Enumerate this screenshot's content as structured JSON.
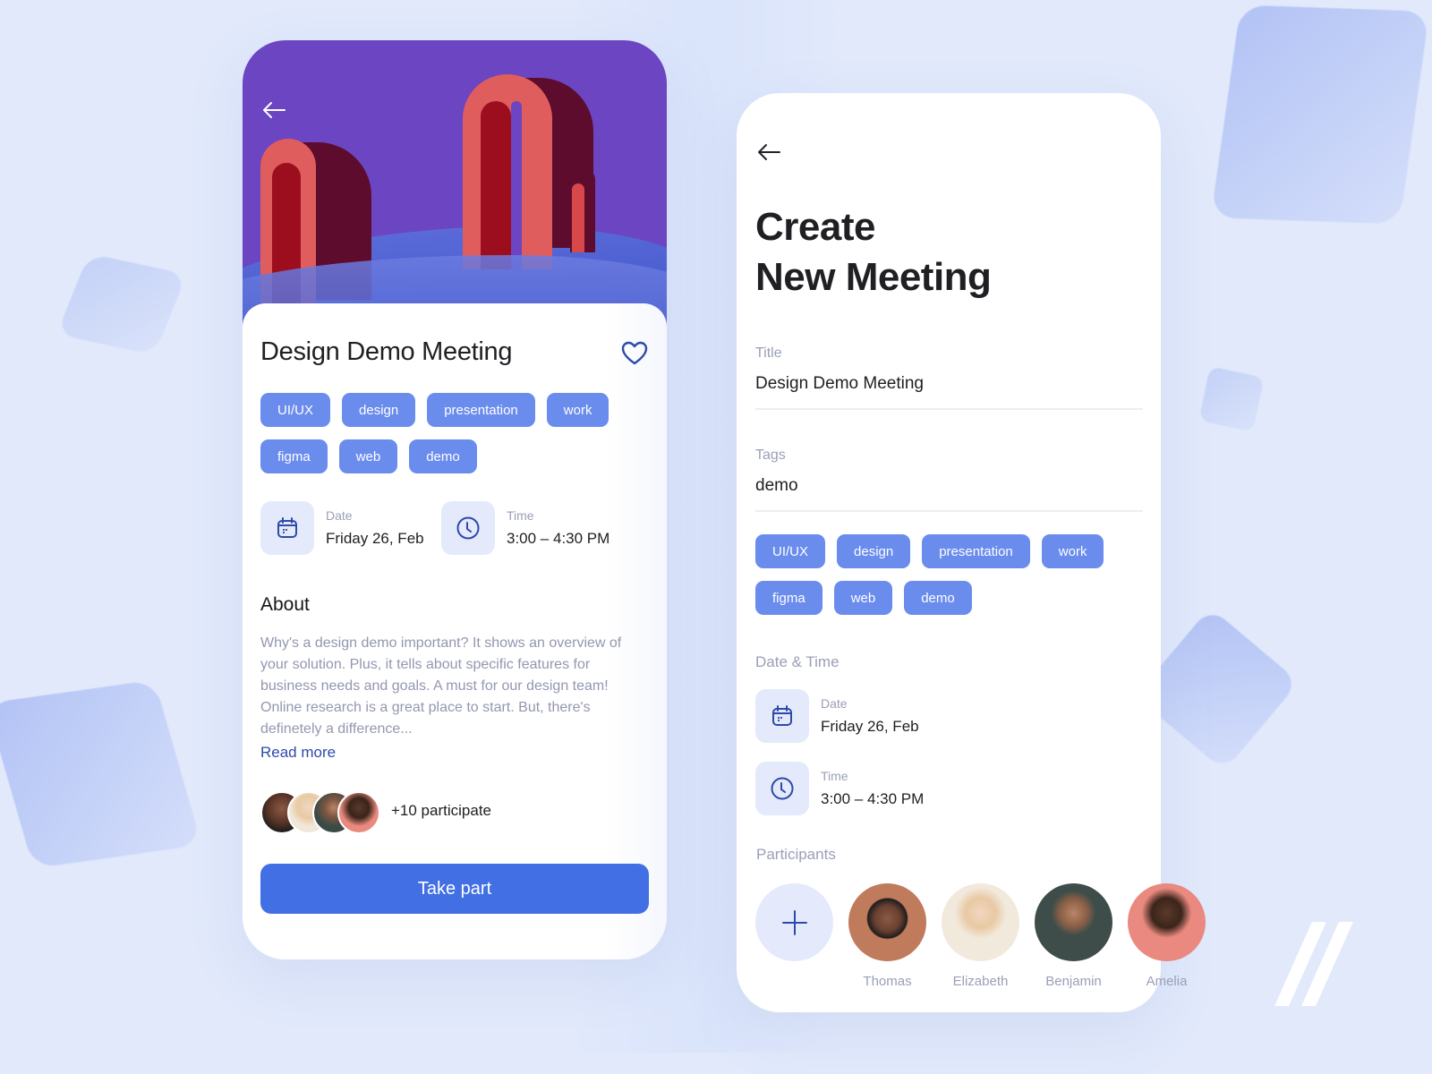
{
  "colors": {
    "background": "#e1e9fb",
    "hero_purple": "#6b45c2",
    "tag_blue": "#6a8ced",
    "primary_button": "#4270e4",
    "icon_stroke": "#2d4aa8",
    "muted_text": "#9a9fb7"
  },
  "detail_screen": {
    "back_icon": "arrow-left-icon",
    "title": "Design Demo Meeting",
    "favorite_icon": "heart-outline-icon",
    "tags": [
      "UI/UX",
      "design",
      "presentation",
      "work",
      "figma",
      "web",
      "demo"
    ],
    "date": {
      "icon": "calendar-icon",
      "label": "Date",
      "value": "Friday 26, Feb"
    },
    "time": {
      "icon": "clock-icon",
      "label": "Time",
      "value": "3:00 – 4:30 PM"
    },
    "about": {
      "heading": "About",
      "text": "Why's a design demo important? It shows an overview of your solution. Plus, it tells about specific features for business needs and goals. A must for our design team! Online research is a great place to start. But, there's definetely a difference...",
      "read_more": "Read more"
    },
    "participants_summary": "+10 participate",
    "cta": "Take part"
  },
  "create_screen": {
    "back_icon": "arrow-left-icon",
    "title_line1": "Create",
    "title_line2": "New Meeting",
    "title_field": {
      "label": "Title",
      "value": "Design Demo Meeting"
    },
    "tags_field": {
      "label": "Tags",
      "value": "demo"
    },
    "tags": [
      "UI/UX",
      "design",
      "presentation",
      "work",
      "figma",
      "web",
      "demo"
    ],
    "date_time_heading": "Date & Time",
    "date": {
      "icon": "calendar-icon",
      "label": "Date",
      "value": "Friday 26, Feb"
    },
    "time": {
      "icon": "clock-icon",
      "label": "Time",
      "value": "3:00 – 4:30 PM"
    },
    "participants_heading": "Participants",
    "add_participant_icon": "plus-icon",
    "participants": [
      {
        "name": "Thomas"
      },
      {
        "name": "Elizabeth"
      },
      {
        "name": "Benjamin"
      },
      {
        "name": "Amelia"
      }
    ]
  },
  "brand_mark": "double-slash-logo"
}
